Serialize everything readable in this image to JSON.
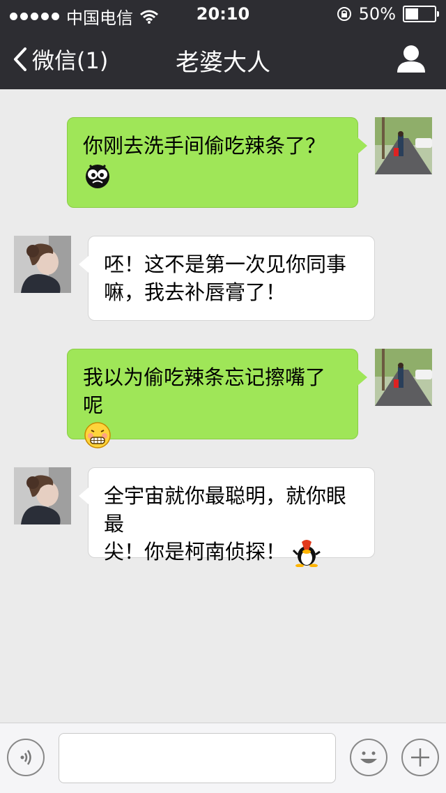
{
  "status_bar": {
    "carrier": "中国电信",
    "time": "20:10",
    "battery": "50%"
  },
  "nav": {
    "back_label": "微信(1)",
    "title": "老婆大人"
  },
  "messages": [
    {
      "sender": "me",
      "text": "你刚去洗手间偷吃辣条了？",
      "emoji": "bug-eyed-emoji-icon"
    },
    {
      "sender": "them",
      "line1": "呸！这不是第一次见你同事",
      "line2": "嘛，我去补唇膏了！"
    },
    {
      "sender": "me",
      "text": "我以为偷吃辣条忘记擦嘴了呢",
      "emoji": "grinning-face-emoji-icon"
    },
    {
      "sender": "them",
      "line1": "全宇宙就你最聪明，就你眼最",
      "line2": "尖！你是柯南侦探！",
      "emoji": "qq-penguin-emoji-icon"
    }
  ],
  "input_bar": {
    "voice_icon": "voice-icon",
    "emoji_icon": "smiley-icon",
    "more_icon": "plus-icon"
  },
  "colors": {
    "header_bg": "#2d2d32",
    "chat_bg": "#ebebeb",
    "my_bubble": "#9fe658",
    "their_bubble": "#ffffff"
  }
}
